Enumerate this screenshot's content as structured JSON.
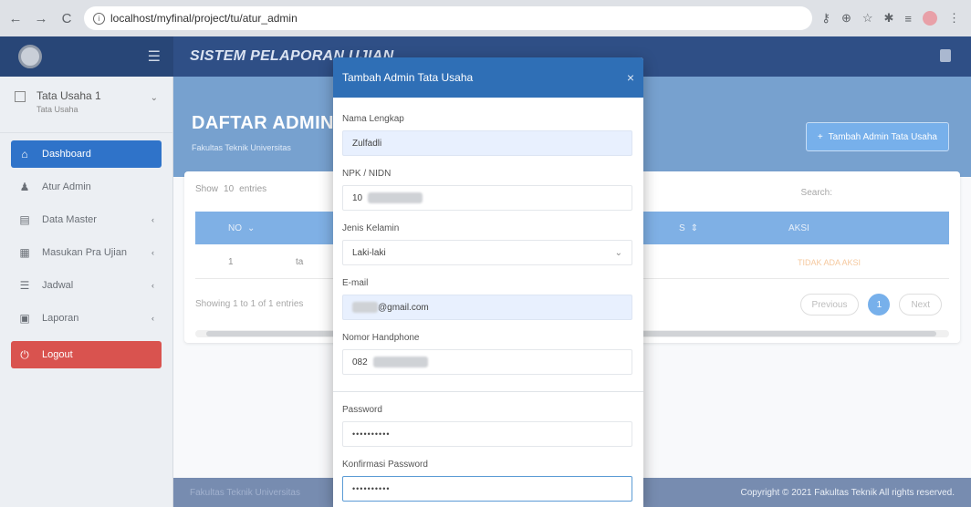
{
  "browser": {
    "url": "localhost/myfinal/project/tu/atur_admin",
    "back": "←",
    "forward": "→",
    "reload": "C",
    "info": "i"
  },
  "header": {
    "title": "SISTEM PELAPORAN UJIAN"
  },
  "sidebar": {
    "user_name": "Tata Usaha 1",
    "user_role": "Tata Usaha",
    "items": [
      {
        "label": "Dashboard",
        "icon": "home-icon",
        "active": true
      },
      {
        "label": "Atur Admin",
        "icon": "user-icon"
      },
      {
        "label": "Data Master",
        "icon": "database-icon"
      },
      {
        "label": "Masukan Pra Ujian",
        "icon": "keyboard-icon"
      },
      {
        "label": "Jadwal",
        "icon": "list-icon"
      },
      {
        "label": "Laporan",
        "icon": "report-icon"
      }
    ],
    "logout": "Logout"
  },
  "main": {
    "page_title": "DAFTAR ADMIN",
    "page_subtitle": "Fakultas Teknik Universitas",
    "add_button": "Tambah Admin Tata Usaha",
    "show_label": "Show",
    "show_value": "10",
    "entries_label": "entries",
    "search_label": "Search:",
    "columns": [
      "NO",
      "",
      "",
      "S",
      "AKSI"
    ],
    "row": {
      "no": "1",
      "col2": "ta",
      "aksi": "TIDAK ADA AKSI"
    },
    "showing": "Showing 1 to 1 of 1 entries",
    "previous": "Previous",
    "current_page": "1",
    "next": "Next"
  },
  "footer": {
    "left": "Fakultas Teknik Universitas",
    "right": "Copyright © 2021 Fakultas Teknik All rights reserved."
  },
  "modal": {
    "title": "Tambah Admin Tata Usaha",
    "close": "×",
    "fields": {
      "nama_label": "Nama Lengkap",
      "nama_value": "Zulfadli",
      "npk_label": "NPK / NIDN",
      "npk_value": "10",
      "jk_label": "Jenis Kelamin",
      "jk_value": "Laki-laki",
      "email_label": "E-mail",
      "email_value": "@gmail.com",
      "hp_label": "Nomor Handphone",
      "hp_value": "082",
      "password_label": "Password",
      "password_value": "••••••••••",
      "konfirmasi_label": "Konfirmasi Password",
      "konfirmasi_value": "••••••••••"
    }
  }
}
